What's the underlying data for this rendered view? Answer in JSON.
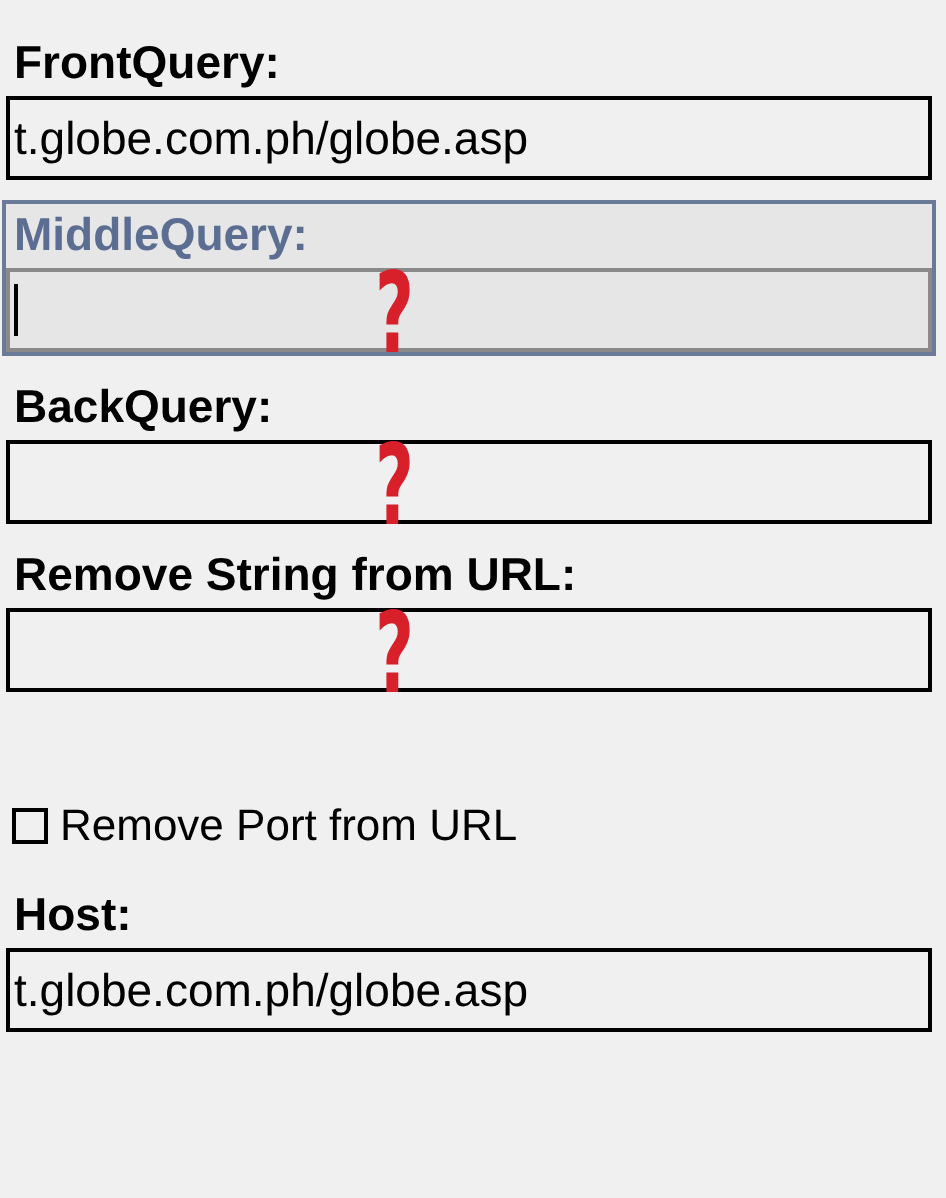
{
  "items": [
    {
      "kind": "field",
      "label": "FrontQuery:",
      "value": "t.globe.com.ph/globe.asp",
      "focused": false
    },
    {
      "kind": "field",
      "label": "MiddleQuery:",
      "value": "",
      "focused": true,
      "annotation": "?"
    },
    {
      "kind": "field",
      "label": "BackQuery:",
      "value": "",
      "focused": false,
      "annotation": "?"
    },
    {
      "kind": "field",
      "label": "Remove String from URL:",
      "value": "",
      "focused": false,
      "annotation": "?"
    },
    {
      "kind": "checkbox",
      "label": "Remove Port from URL",
      "checked": false
    },
    {
      "kind": "field",
      "label": "Host:",
      "value": "t.globe.com.ph/globe.asp",
      "focused": false
    }
  ]
}
